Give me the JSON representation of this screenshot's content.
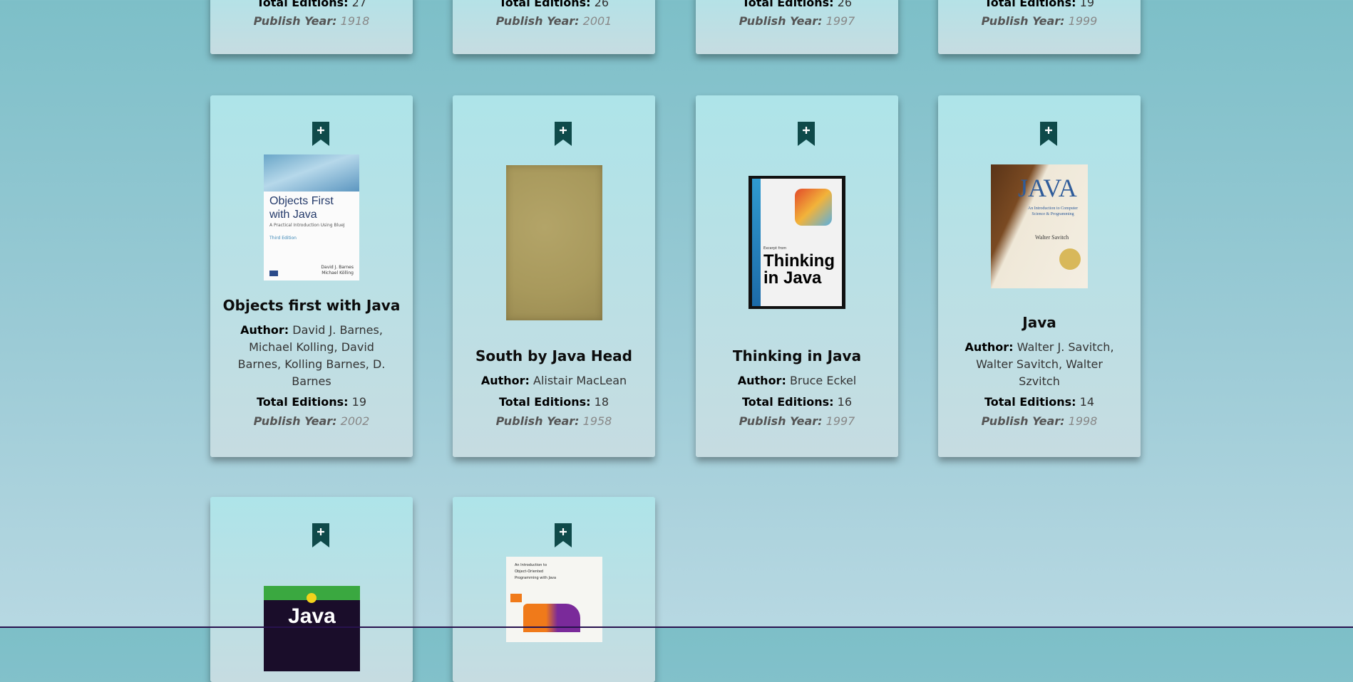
{
  "labels": {
    "author": "Author:",
    "total_editions": "Total Editions:",
    "publish_year": "Publish Year:"
  },
  "top_row": [
    {
      "total_editions": "27",
      "publish_year": "1918"
    },
    {
      "total_editions": "26",
      "publish_year": "2001"
    },
    {
      "total_editions": "26",
      "publish_year": "1997"
    },
    {
      "total_editions": "19",
      "publish_year": "1999"
    }
  ],
  "books": [
    {
      "title": "Objects first with Java",
      "author": "David J. Barnes, Michael Kolling, David Barnes, Kolling Barnes, D. Barnes",
      "total_editions": "19",
      "publish_year": "2002"
    },
    {
      "title": "South by Java Head",
      "author": "Alistair MacLean",
      "total_editions": "18",
      "publish_year": "1958"
    },
    {
      "title": "Thinking in Java",
      "author": "Bruce Eckel",
      "total_editions": "16",
      "publish_year": "1997"
    },
    {
      "title": "Java",
      "author": "Walter J. Savitch, Walter Savitch, Walter Szvitch",
      "total_editions": "14",
      "publish_year": "1998"
    }
  ],
  "bottom_row": [
    {
      "cover_text": "Java"
    },
    {
      "cover_text": "An Introduction to Object-Oriented Programming with Java"
    }
  ],
  "covers": {
    "objects_first": {
      "title": "Objects First with Java",
      "subtitle": "A Practical Introduction Using BlueJ",
      "edition": "Third Edition",
      "authors": "David J. Barnes Michael Kölling"
    },
    "thinking": {
      "small": "Excerpt from",
      "main": "Thinking in Java"
    },
    "java_savitch": {
      "main": "JAVA",
      "sub": "An Introduction to Computer Science & Programming",
      "author": "Walter Savitch"
    }
  },
  "colors": {
    "bookmark": "#0f4a4a",
    "accent_bar": "#28124e"
  }
}
